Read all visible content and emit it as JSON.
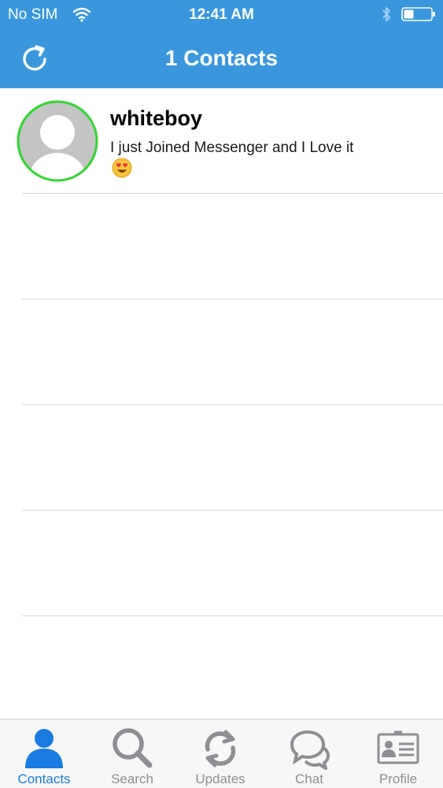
{
  "status_bar": {
    "carrier": "No SIM",
    "time": "12:41 AM"
  },
  "nav": {
    "title": "1 Contacts",
    "refresh_icon": "refresh-icon"
  },
  "contacts": [
    {
      "name": "whiteboy",
      "status": "I just Joined Messenger and I Love it",
      "emoji": "heart-eyes-emoji",
      "online_ring_color": "#2ed82e"
    }
  ],
  "tabs": [
    {
      "label": "Contacts",
      "icon": "person-icon",
      "active": true
    },
    {
      "label": "Search",
      "icon": "magnifier-icon",
      "active": false
    },
    {
      "label": "Updates",
      "icon": "sync-icon",
      "active": false
    },
    {
      "label": "Chat",
      "icon": "chat-bubbles-icon",
      "active": false
    },
    {
      "label": "Profile",
      "icon": "id-card-icon",
      "active": false
    }
  ],
  "colors": {
    "header": "#3a97de",
    "active_tab": "#1a7be0",
    "inactive_tab": "#8e8e93"
  }
}
